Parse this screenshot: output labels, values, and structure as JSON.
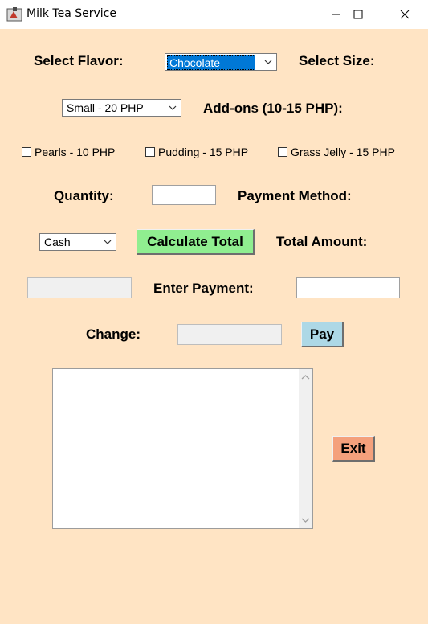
{
  "window": {
    "title": "Milk Tea Service",
    "icon": "java-app-icon",
    "controls": [
      "minimize-icon",
      "maximize-icon",
      "close-icon"
    ]
  },
  "form": {
    "flavor_label": "Select Flavor:",
    "flavor_selected": "Chocolate",
    "size_label": "Select Size:",
    "size_selected": "Small - 20 PHP",
    "addons_label": "Add-ons (10-15 PHP):",
    "addons": [
      {
        "label": "Pearls - 10 PHP",
        "checked": false
      },
      {
        "label": "Pudding - 15 PHP",
        "checked": false
      },
      {
        "label": "Grass Jelly - 15 PHP",
        "checked": false
      }
    ],
    "quantity_label": "Quantity:",
    "quantity_value": "",
    "payment_method_label": "Payment Method:",
    "payment_method_selected": "Cash",
    "calculate_button": "Calculate Total",
    "total_label": "Total Amount:",
    "total_value": "",
    "payment_label": "Enter Payment:",
    "payment_value": "",
    "change_label": "Change:",
    "change_value": "",
    "pay_button": "Pay",
    "receipt_text": "",
    "exit_button": "Exit"
  },
  "colors": {
    "background": "#ffe4c4",
    "calculate_button": "#90ee90",
    "pay_button": "#add8e6",
    "exit_button": "#f4a07c",
    "selection": "#0078d7"
  }
}
